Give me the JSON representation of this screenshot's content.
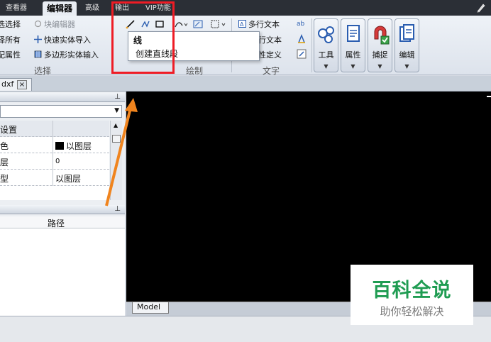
{
  "menubar": {
    "tabs": [
      {
        "label": "查看器",
        "active": false
      },
      {
        "label": "编辑器",
        "active": true
      },
      {
        "label": "高级",
        "active": false
      },
      {
        "label": "输出",
        "active": false
      },
      {
        "label": "VIP功能",
        "active": false
      }
    ]
  },
  "ribbon": {
    "select_group": {
      "items": [
        "选选择",
        "择所有",
        "配属性"
      ],
      "label": "选择"
    },
    "editor_group": {
      "items": [
        "块编辑器",
        "快速实体导入",
        "多边形实体输入"
      ]
    },
    "draw_group": {
      "label": "绘制"
    },
    "text_group": {
      "items": [
        "多行文本",
        "行文本",
        "性定义"
      ],
      "label": "文字"
    },
    "big_buttons": [
      {
        "label": "工具"
      },
      {
        "label": "属性"
      },
      {
        "label": "捕捉"
      },
      {
        "label": "编辑"
      }
    ]
  },
  "dropdown": {
    "title": "线",
    "description": "创建直线段"
  },
  "doc_tab": {
    "label": "dxf",
    "close": "×"
  },
  "properties": {
    "header": "设置",
    "rows": [
      {
        "key": "颜色",
        "value": "以图层"
      },
      {
        "key": "图层",
        "value": "0"
      },
      {
        "key": "线型",
        "value": "以图层"
      }
    ]
  },
  "list_panel": {
    "column": "路径"
  },
  "canvas": {
    "layout_tab": "Model"
  },
  "watermark": {
    "title": "百科全说",
    "subtitle": "助你轻松解决"
  },
  "colors": {
    "accent_red": "#ee1c25",
    "arrow": "#f0841e",
    "watermark_green": "#1f9c52"
  }
}
